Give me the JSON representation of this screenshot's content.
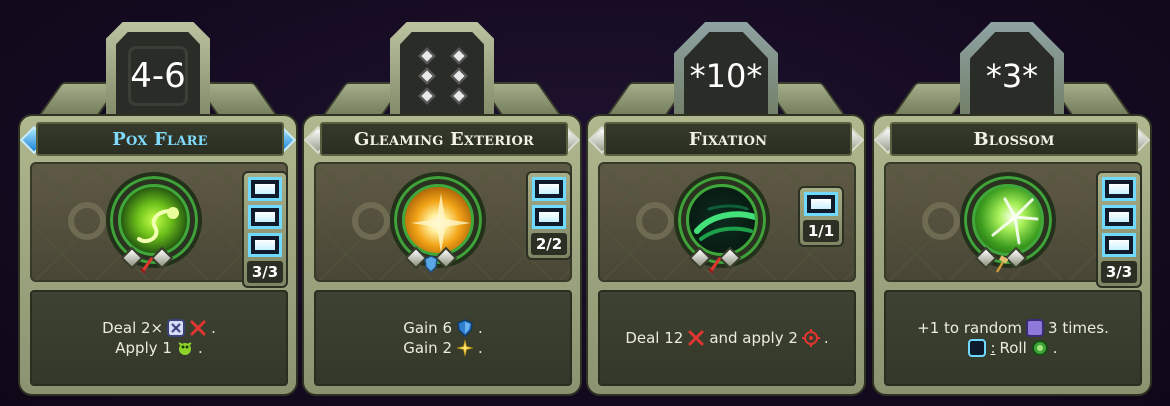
{
  "cards": [
    {
      "title": "Pox Flare",
      "cost": "4-6",
      "uses": "3/3",
      "charges": 3,
      "lines": [
        {
          "a": "Deal 2×",
          "b": "",
          "c": "."
        },
        {
          "a": "Apply 1",
          "b": "",
          "c": "."
        }
      ],
      "icons": [
        "dice-x-icon",
        "damage-icon",
        "poison-bug-icon"
      ]
    },
    {
      "title": "Gleaming Exterior",
      "cost": "",
      "uses": "2/2",
      "charges": 2,
      "lines": [
        {
          "a": "Gain 6",
          "b": "",
          "c": "."
        },
        {
          "a": "Gain 2",
          "b": "",
          "c": "."
        }
      ],
      "icons": [
        "shield-icon",
        "spark-icon"
      ]
    },
    {
      "title": "Fixation",
      "cost": "*10*",
      "uses": "1/1",
      "charges": 1,
      "lines": [
        {
          "a": "Deal 12",
          "b": "and apply 2",
          "c": "."
        }
      ],
      "icons": [
        "damage-icon",
        "target-icon"
      ]
    },
    {
      "title": "Blossom",
      "cost": "*3*",
      "uses": "3/3",
      "charges": 3,
      "lines": [
        {
          "a": "+1 to random",
          "b": "3 times.",
          "c": ""
        },
        {
          "a": ":",
          "b": "Roll",
          "c": "."
        }
      ],
      "icons": [
        "purple-die-icon",
        "blue-die-icon",
        "green-gear-icon"
      ]
    }
  ],
  "colors": {
    "title_blue": "#7fdcff",
    "charge_blue": "#6fd9ff",
    "text_light": "#ececde"
  }
}
